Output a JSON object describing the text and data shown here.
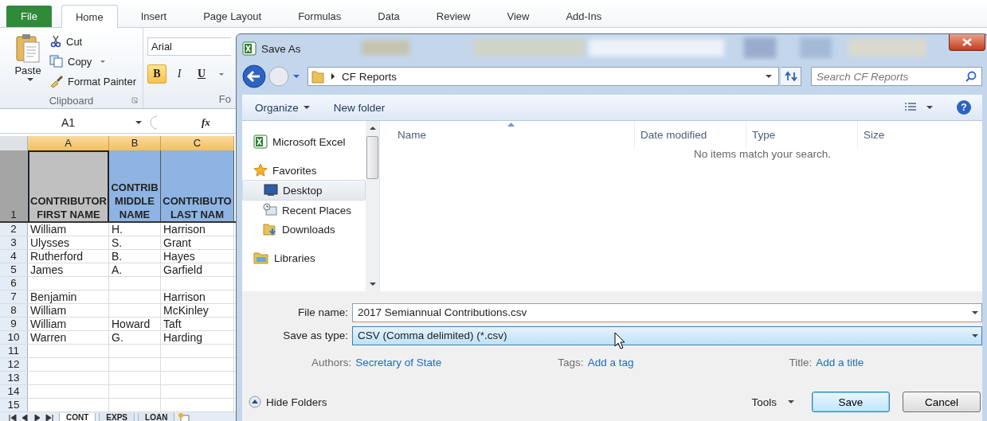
{
  "ribbon": {
    "tabs": [
      {
        "label": "File",
        "kind": "file",
        "selected": false
      },
      {
        "label": "Home",
        "kind": "tab",
        "selected": true
      },
      {
        "label": "Insert",
        "kind": "tab",
        "selected": false
      },
      {
        "label": "Page Layout",
        "kind": "tab",
        "selected": false
      },
      {
        "label": "Formulas",
        "kind": "tab",
        "selected": false
      },
      {
        "label": "Data",
        "kind": "tab",
        "selected": false
      },
      {
        "label": "Review",
        "kind": "tab",
        "selected": false
      },
      {
        "label": "View",
        "kind": "tab",
        "selected": false
      },
      {
        "label": "Add-Ins",
        "kind": "tab",
        "selected": false
      }
    ],
    "clipboard": {
      "paste": "Paste",
      "cut": "Cut",
      "copy": "Copy",
      "format_painter": "Format Painter",
      "label": "Clipboard"
    },
    "font": {
      "name": "Arial",
      "label": "Fo",
      "buttons": [
        {
          "label": "B",
          "kind": "bold",
          "on": true
        },
        {
          "label": "I",
          "kind": "italic",
          "on": false
        },
        {
          "label": "U",
          "kind": "underline",
          "on": false
        }
      ]
    }
  },
  "formula_bar": {
    "name_box": "A1",
    "function_label": "fx"
  },
  "sheet": {
    "columns": [
      {
        "label": "A"
      },
      {
        "label": "B"
      },
      {
        "label": "C"
      }
    ],
    "rows": [
      {
        "number": "1",
        "cells": [
          {
            "text": "CONTRIBUTOR\nFIRST NAME",
            "selected": true
          },
          {
            "text": "CONTRIB\nMIDDLE\nNAME",
            "selected": false
          },
          {
            "text": "CONTRIBUTO\nLAST NAM",
            "selected": false
          }
        ]
      },
      {
        "number": "2",
        "cells": [
          {
            "text": "William"
          },
          {
            "text": "H."
          },
          {
            "text": "Harrison"
          }
        ]
      },
      {
        "number": "3",
        "cells": [
          {
            "text": "Ulysses"
          },
          {
            "text": "S."
          },
          {
            "text": "Grant"
          }
        ]
      },
      {
        "number": "4",
        "cells": [
          {
            "text": "Rutherford"
          },
          {
            "text": "B."
          },
          {
            "text": "Hayes"
          }
        ]
      },
      {
        "number": "5",
        "cells": [
          {
            "text": "James"
          },
          {
            "text": "A."
          },
          {
            "text": "Garfield"
          }
        ]
      },
      {
        "number": "6",
        "cells": []
      },
      {
        "number": "7",
        "cells": [
          {
            "text": "Benjamin"
          },
          {
            "text": ""
          },
          {
            "text": "Harrison"
          }
        ]
      },
      {
        "number": "8",
        "cells": [
          {
            "text": "William"
          },
          {
            "text": ""
          },
          {
            "text": "McKinley"
          }
        ]
      },
      {
        "number": "9",
        "cells": [
          {
            "text": "William"
          },
          {
            "text": "Howard"
          },
          {
            "text": "Taft"
          }
        ]
      },
      {
        "number": "10",
        "cells": [
          {
            "text": "Warren"
          },
          {
            "text": "G."
          },
          {
            "text": "Harding"
          }
        ]
      },
      {
        "number": "11",
        "cells": []
      },
      {
        "number": "12",
        "cells": []
      },
      {
        "number": "13",
        "cells": []
      },
      {
        "number": "14",
        "cells": []
      },
      {
        "number": "15",
        "cells": []
      }
    ],
    "tabs": [
      {
        "label": "CONT",
        "selected": true
      },
      {
        "label": "EXPS",
        "selected": false
      },
      {
        "label": "LOAN",
        "selected": false
      }
    ]
  },
  "dialog": {
    "title": "Save As",
    "address": "CF Reports",
    "search_placeholder": "Search CF Reports",
    "toolbar": {
      "organize": "Organize",
      "new_folder": "New folder",
      "help": "?"
    },
    "nav": [
      {
        "label": "Microsoft Excel",
        "kind": "excel",
        "selected": false
      },
      {
        "label": "Favorites",
        "kind": "favorites",
        "selected": false,
        "children": [
          {
            "label": "Desktop",
            "kind": "desktop",
            "selected": true
          },
          {
            "label": "Recent Places",
            "kind": "recent",
            "selected": false
          },
          {
            "label": "Downloads",
            "kind": "downloads",
            "selected": false
          }
        ]
      },
      {
        "label": "Libraries",
        "kind": "libraries",
        "selected": false
      }
    ],
    "columns": [
      "Name",
      "Date modified",
      "Type",
      "Size"
    ],
    "empty_message": "No items match your search.",
    "file_name": {
      "label": "File name:",
      "value": "2017 Semiannual Contributions.csv"
    },
    "save_type": {
      "label": "Save as type:",
      "value": "CSV (Comma delimited) (*.csv)"
    },
    "meta": [
      {
        "label": "Authors:",
        "value": "Secretary of State"
      },
      {
        "label": "Tags:",
        "value": "Add a tag"
      },
      {
        "label": "Title:",
        "value": "Add a title"
      }
    ],
    "hide_folders": "Hide Folders",
    "tools": "Tools",
    "save": "Save",
    "cancel": "Cancel"
  }
}
